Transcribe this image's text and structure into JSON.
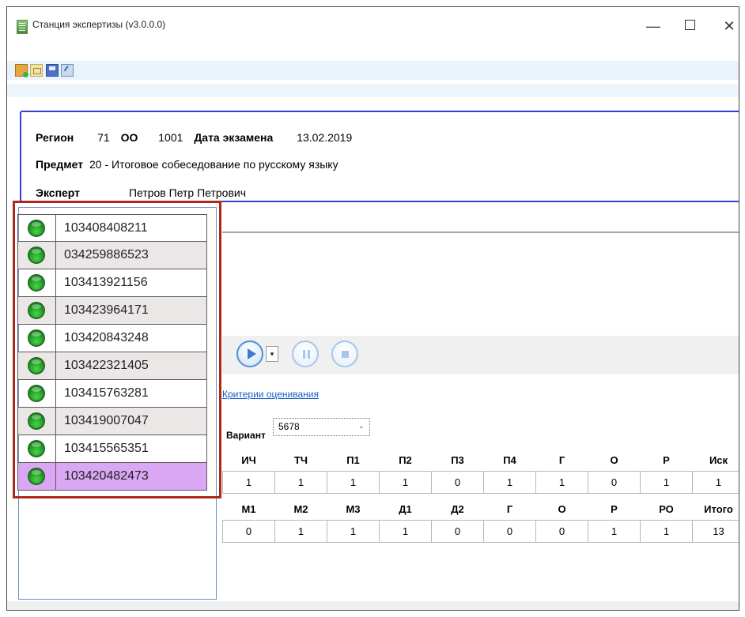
{
  "window": {
    "title": "Станция экспертизы (v3.0.0.0)",
    "minimize": "—",
    "close": "✕"
  },
  "toolbar": {
    "buttons": [
      "open-folder-icon",
      "folder-icon",
      "save-icon",
      "edit-icon"
    ]
  },
  "info": {
    "region_label": "Регион",
    "region_value": "71",
    "oo_label": "ОО",
    "oo_value": "1001",
    "date_label": "Дата экзамена",
    "date_value": "13.02.2019",
    "subject_label": "Предмет",
    "subject_value": "20 - Итоговое собеседование по русскому языку",
    "expert_label": "Эксперт",
    "expert_value": "Петров Петр Петрович"
  },
  "participants": [
    "103408408211",
    "034259886523",
    "103413921156",
    "103423964171",
    "103420843248",
    "103422321405",
    "103415763281",
    "103419007047",
    "103415565351",
    "103420482473"
  ],
  "selected_index": 9,
  "player": {
    "dropdown_glyph": "▾"
  },
  "criteria_link": "Критерии оценивания",
  "variant": {
    "label": "Вариант",
    "value": "5678",
    "arrow": "⌄"
  },
  "scores_1": {
    "headers": [
      "ИЧ",
      "ТЧ",
      "П1",
      "П2",
      "П3",
      "П4",
      "Г",
      "О",
      "Р",
      "Иск"
    ],
    "values": [
      "1",
      "1",
      "1",
      "1",
      "0",
      "1",
      "1",
      "0",
      "1",
      "1"
    ]
  },
  "scores_2": {
    "headers": [
      "М1",
      "М2",
      "М3",
      "Д1",
      "Д2",
      "Г",
      "О",
      "Р",
      "РО",
      "Итого"
    ],
    "values": [
      "0",
      "1",
      "1",
      "1",
      "0",
      "0",
      "0",
      "1",
      "1",
      "13"
    ]
  },
  "colors": {
    "accent": "#3b3bdc",
    "highlight_border": "#b0281b",
    "selected_row": "#d9a7f3",
    "link": "#1a5fc0"
  }
}
